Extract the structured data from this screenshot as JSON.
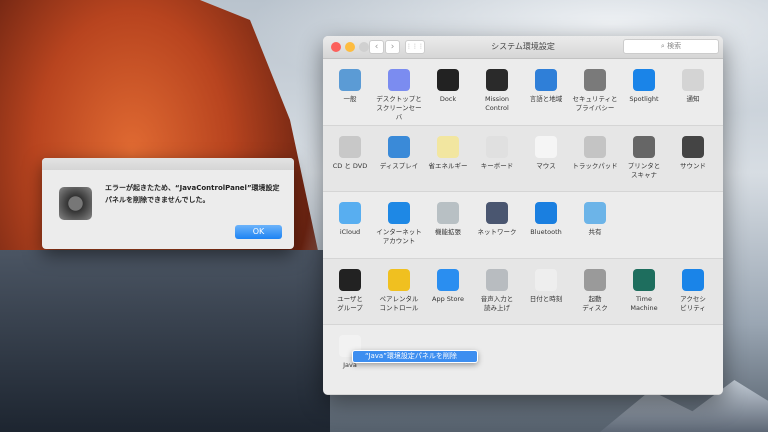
{
  "window": {
    "title": "システム環境設定",
    "search_placeholder": "検索",
    "back": "‹",
    "forward": "›",
    "grid": "⋮⋮⋮"
  },
  "sections": [
    [
      {
        "label": "一般",
        "color": "#5b9bd5"
      },
      {
        "label": "デスクトップと\nスクリーンセーバ",
        "color": "#7b8cf0"
      },
      {
        "label": "Dock",
        "color": "#222222"
      },
      {
        "label": "Mission\nControl",
        "color": "#2a2a2a"
      },
      {
        "label": "言語と地域",
        "color": "#2f7fd8"
      },
      {
        "label": "セキュリティと\nプライバシー",
        "color": "#7a7a7a"
      },
      {
        "label": "Spotlight",
        "color": "#1a84e8"
      },
      {
        "label": "通知",
        "color": "#d4d4d4"
      }
    ],
    [
      {
        "label": "CD と DVD",
        "color": "#c8c8c8"
      },
      {
        "label": "ディスプレイ",
        "color": "#3a8ad8"
      },
      {
        "label": "省エネルギー",
        "color": "#f2e6a0"
      },
      {
        "label": "キーボード",
        "color": "#e0e0e0"
      },
      {
        "label": "マウス",
        "color": "#f5f5f5"
      },
      {
        "label": "トラックパッド",
        "color": "#c4c4c4"
      },
      {
        "label": "プリンタと\nスキャナ",
        "color": "#666666"
      },
      {
        "label": "サウンド",
        "color": "#444444"
      }
    ],
    [
      {
        "label": "iCloud",
        "color": "#58aef0"
      },
      {
        "label": "インターネット\nアカウント",
        "color": "#1e88e5"
      },
      {
        "label": "機能拡張",
        "color": "#b8c0c4"
      },
      {
        "label": "ネットワーク",
        "color": "#4a5670"
      },
      {
        "label": "Bluetooth",
        "color": "#1a7fe0"
      },
      {
        "label": "共有",
        "color": "#6cb4e8"
      }
    ],
    [
      {
        "label": "ユーザと\nグループ",
        "color": "#222222"
      },
      {
        "label": "ペアレンタル\nコントロール",
        "color": "#f0c020"
      },
      {
        "label": "App Store",
        "color": "#2a8ef0"
      },
      {
        "label": "音声入力と\n読み上げ",
        "color": "#b8bcc0"
      },
      {
        "label": "日付と時刻",
        "color": "#eeeeee"
      },
      {
        "label": "起動\nディスク",
        "color": "#9a9a9a"
      },
      {
        "label": "Time\nMachine",
        "color": "#1e6e5e"
      },
      {
        "label": "アクセシ\nビリティ",
        "color": "#1a84e8"
      }
    ],
    [
      {
        "label": "Java",
        "color": "#f2f2f2"
      }
    ]
  ],
  "context_menu": {
    "item": "“Java”環境設定パネルを削除"
  },
  "dialog": {
    "message": "エラーが起きたため、“JavaControlPanel”環境設定パネルを削除できませんでした。",
    "ok": "OK"
  }
}
